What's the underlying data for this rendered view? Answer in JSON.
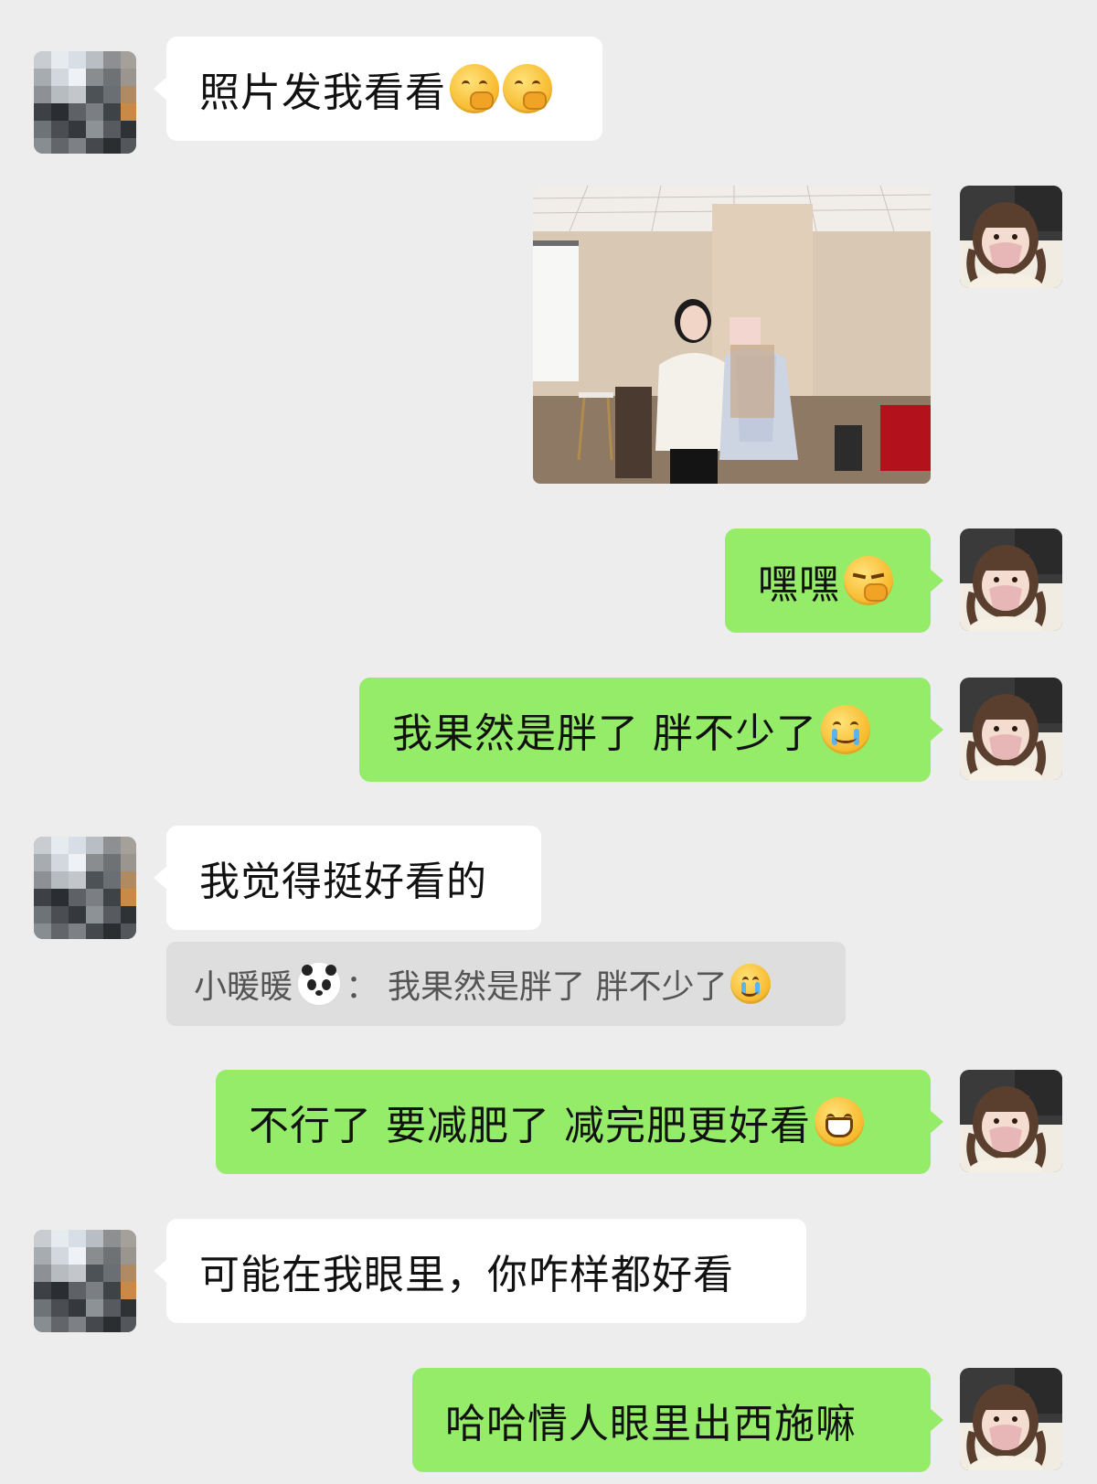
{
  "contacts": {
    "other": {
      "avatar": "pixelated-avatar"
    },
    "me": {
      "avatar": "girl-with-braids-avatar"
    }
  },
  "messages": [
    {
      "side": "in",
      "text": "照片发我看看",
      "emojis": [
        "thinking-face-emoji",
        "thinking-face-emoji"
      ]
    },
    {
      "side": "out",
      "type": "image",
      "image": "photo-two-women-in-room"
    },
    {
      "side": "out",
      "text": "嘿嘿",
      "emojis": [
        "smirk-face-emoji"
      ]
    },
    {
      "side": "out",
      "text": "我果然是胖了 胖不少了",
      "emojis": [
        "crying-face-emoji"
      ]
    },
    {
      "side": "in",
      "text": "我觉得挺好看的",
      "quote": {
        "sender": "小暖暖",
        "separator": "：",
        "text": "我果然是胖了 胖不少了",
        "emojis": [
          "panda-emoji",
          "crying-face-emoji"
        ]
      }
    },
    {
      "side": "out",
      "text": "不行了 要减肥了 减完肥更好看",
      "emojis": [
        "grin-face-emoji"
      ]
    },
    {
      "side": "in",
      "text": "可能在我眼里，你咋样都好看"
    },
    {
      "side": "out",
      "text": "哈哈情人眼里出西施嘛"
    }
  ],
  "colors": {
    "background": "#ededed",
    "incoming": "#ffffff",
    "outgoing": "#95ec69"
  }
}
